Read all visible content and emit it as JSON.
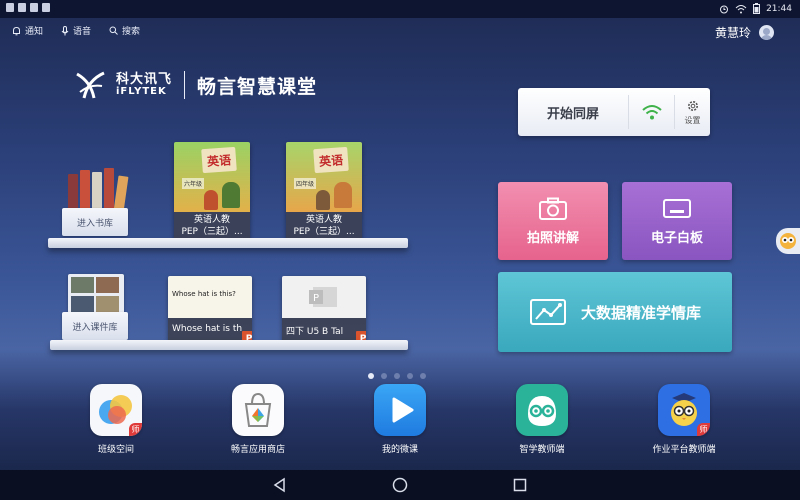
{
  "status_bar": {
    "time": "21:44"
  },
  "toolbar": {
    "notify_label": "通知",
    "voice_label": "语音",
    "search_label": "搜索"
  },
  "user": {
    "name": "黄慧玲"
  },
  "logo": {
    "brand_cn": "科大讯飞",
    "brand_en": "iFLYTEK",
    "product": "畅言智慧课堂"
  },
  "library": {
    "enter_books_label": "进入书库",
    "enter_courses_label": "进入课件库",
    "books": [
      {
        "title": "英语",
        "grade": "六年级",
        "caption_line1": "英语人教",
        "caption_line2": "PEP（三起）..."
      },
      {
        "title": "英语",
        "grade": "四年级",
        "caption_line1": "英语人教",
        "caption_line2": "PEP（三起）..."
      }
    ],
    "coursewares": [
      {
        "slide_text": "Whose hat is this?",
        "caption": "Whose hat is th",
        "badge": "P"
      },
      {
        "slide_text": "",
        "caption": "四下 U5 B Tal",
        "badge": "P"
      }
    ]
  },
  "screen_cast": {
    "label": "开始同屏",
    "settings_label": "设置"
  },
  "tiles": {
    "photo_label": "拍照讲解",
    "whiteboard_label": "电子白板",
    "bigdata_label": "大数据精准学情库"
  },
  "pager": {
    "count": 5,
    "active_index": 0
  },
  "dock": {
    "apps": [
      {
        "label": "班级空间",
        "icon": "class-space-icon",
        "badge": "师"
      },
      {
        "label": "畅言应用商店",
        "icon": "app-store-icon",
        "badge": ""
      },
      {
        "label": "我的微课",
        "icon": "micro-lesson-icon",
        "badge": ""
      },
      {
        "label": "智学教师端",
        "icon": "zhixue-teacher-icon",
        "badge": ""
      },
      {
        "label": "作业平台教师端",
        "icon": "homework-teacher-icon",
        "badge": "师"
      }
    ]
  },
  "colors": {
    "photo_tile": "#e6638d",
    "whiteboard_tile": "#8a55c0",
    "bigdata_tile": "#3aa8bd",
    "wifi_green": "#3fb24a"
  }
}
